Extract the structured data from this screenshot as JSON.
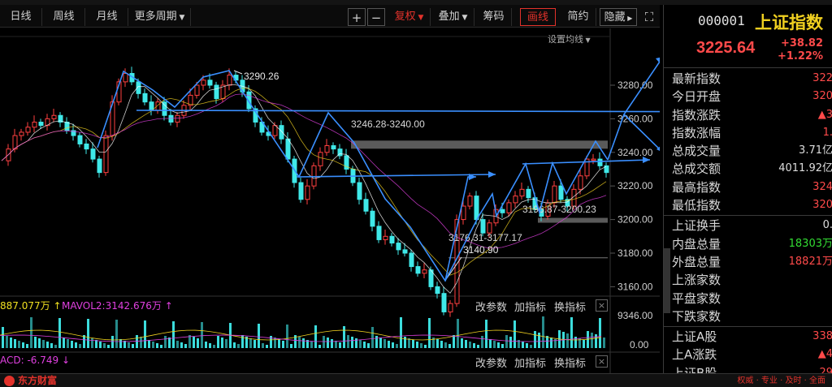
{
  "toolbar": {
    "daily": "日线",
    "weekly": "周线",
    "monthly": "月线",
    "more_periods": "更多周期",
    "plus": "+",
    "minus": "−",
    "restore_rights": "复权",
    "overlay": "叠加",
    "chips": "筹码",
    "draw_line": "画线",
    "simple": "简约",
    "hide": "隐藏"
  },
  "chart": {
    "set_ma": "设置均线",
    "price_axis": [
      "3280.00",
      "3260.00",
      "3240.00",
      "3220.00",
      "3200.00",
      "3180.00",
      "3160.00"
    ],
    "labels": {
      "high": "3290.26",
      "range1": "3246.28-3240.00",
      "range2": "3196.87-3200.23",
      "range3": "3176.31-3177.17",
      "low": "3140.90"
    },
    "vol_info": "887.077万",
    "vol_ma": "MAVOL2:3142.676万",
    "vol_axis": [
      "9346.00",
      "0.00"
    ],
    "macd_info": "ACD: -6.749",
    "params_btn": "改参数",
    "add_ind_btn": "加指标",
    "swap_ind_btn": "换指标",
    "close_btn": "×",
    "colors": {
      "up": "#ff4040",
      "down": "#3fe8e8",
      "draw": "#3a8fff",
      "ink": "#e02424"
    }
  },
  "quote": {
    "code": "000001",
    "name": "上证指数",
    "price": "3225.64",
    "change": "+38.82",
    "change_pct": "+1.22%"
  },
  "stats": [
    {
      "label": "最新指数",
      "value": "322",
      "color": "red"
    },
    {
      "label": "今日开盘",
      "value": "320",
      "color": "red"
    },
    {
      "label": "指数涨跌",
      "value": "▲3",
      "color": "red"
    },
    {
      "label": "指数涨幅",
      "value": "1.",
      "color": "red"
    },
    {
      "label": "总成交量",
      "value": "3.71亿",
      "color": "white"
    },
    {
      "label": "总成交额",
      "value": "4011.92亿",
      "color": "white"
    },
    {
      "label": "最高指数",
      "value": "324",
      "color": "red"
    },
    {
      "label": "最低指数",
      "value": "320",
      "color": "red"
    }
  ],
  "stats2": [
    {
      "label": "上证换手",
      "value": "0.",
      "color": "white"
    },
    {
      "label": "内盘总量",
      "value": "18303万",
      "color": "green"
    },
    {
      "label": "外盘总量",
      "value": "18821万",
      "color": "red"
    },
    {
      "label": "上涨家数",
      "value": "",
      "color": "red"
    },
    {
      "label": "平盘家数",
      "value": "",
      "color": "white"
    },
    {
      "label": "下跌家数",
      "value": "",
      "color": "green"
    }
  ],
  "stats3": [
    {
      "label": "上证A股",
      "value": "338",
      "color": "red"
    },
    {
      "label": "上A涨跌",
      "value": "▲4",
      "color": "red"
    },
    {
      "label": "上证B股",
      "value": "29",
      "color": "red"
    }
  ],
  "footer": {
    "brand": "东方财富",
    "slogan": "权威 · 专业 · 及时 · 全面"
  }
}
